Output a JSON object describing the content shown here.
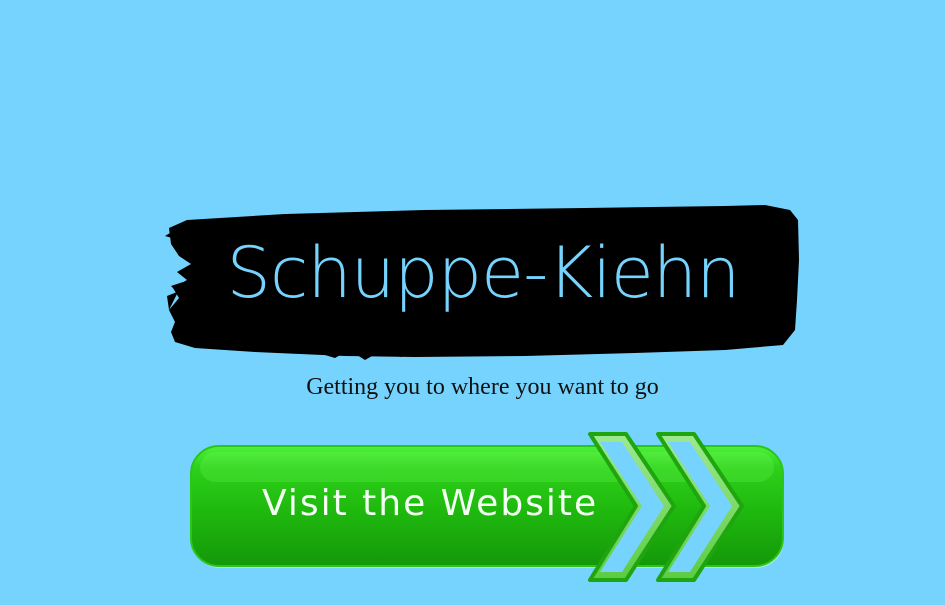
{
  "brand": {
    "name": "Schuppe-Kiehn",
    "tagline": "Getting you to where you want to go"
  },
  "cta": {
    "label": "Visit the Website",
    "icon": "double-chevron-right-icon"
  },
  "colors": {
    "background": "#75d3fd",
    "banner": "#000000",
    "brand_text": "#75d3fd",
    "button_green": "#1fb80e",
    "button_border": "#18a10a",
    "chevron_fill": "#75d3fd"
  }
}
